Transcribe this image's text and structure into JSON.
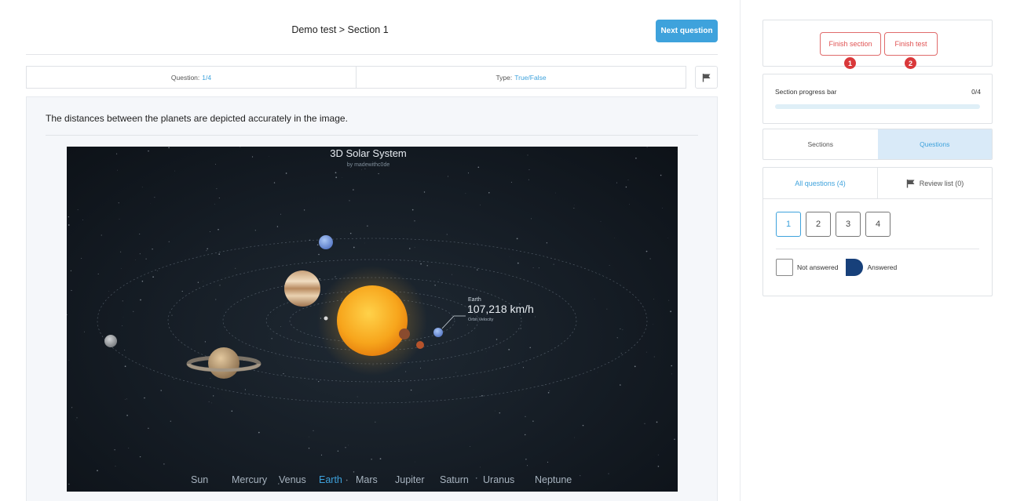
{
  "header": {
    "breadcrumb": "Demo test > Section 1",
    "next_label": "Next question"
  },
  "info": {
    "question_label": "Question:",
    "question_value": "1/4",
    "type_label": "Type:",
    "type_value": "True/False"
  },
  "question": {
    "text": "The distances between the planets are depicted accurately in the image."
  },
  "image": {
    "title": "3D Solar System",
    "subtitle": "by madewithc0de",
    "tooltip_planet": "Earth",
    "tooltip_value": "107,218 km/h",
    "tooltip_caption": "Orbit Velocity",
    "nav": [
      "Sun",
      "Mercury",
      "Venus",
      "Earth",
      "Mars",
      "Jupiter",
      "Saturn",
      "Uranus",
      "Neptune"
    ],
    "nav_active": "Earth",
    "colors": {
      "nav_active": "#3ea2dc",
      "sun": "#f7a51c"
    }
  },
  "sidebar": {
    "finish_section": "Finish section",
    "finish_test": "Finish test",
    "badge_1": "1",
    "badge_2": "2",
    "progress_label": "Section progress bar",
    "progress_count": "0/4",
    "progress_fraction": 0,
    "tab_sections": "Sections",
    "tab_questions": "Questions",
    "all_questions": "All questions (4)",
    "review_list": "Review list (0)",
    "question_numbers": [
      "1",
      "2",
      "3",
      "4"
    ],
    "current_question": "1",
    "legend_not_answered": "Not answered",
    "legend_answered": "Answered"
  },
  "colors": {
    "accent": "#3ea2dc",
    "danger": "#e05252",
    "answered": "#17407a"
  }
}
